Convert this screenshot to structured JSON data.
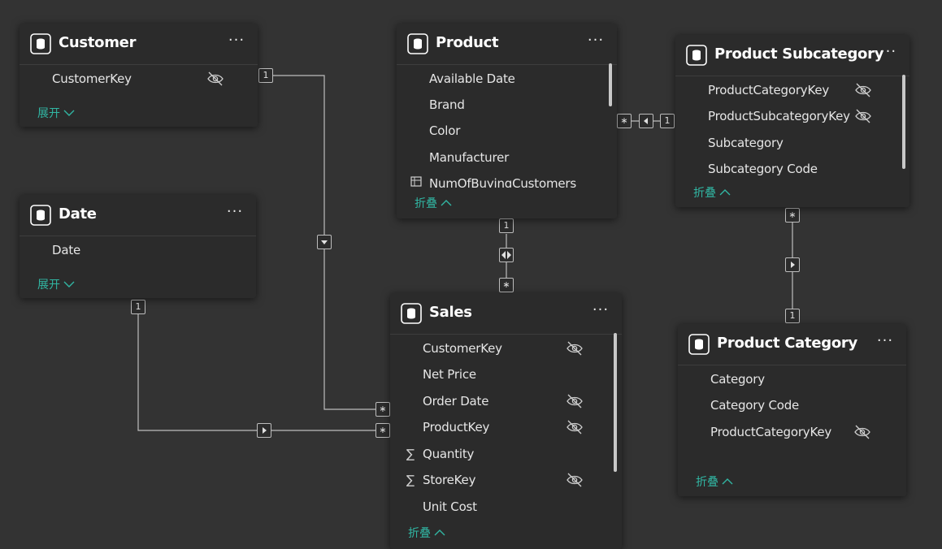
{
  "tables": {
    "customer": {
      "title": "Customer",
      "more": "···",
      "fields": [
        "CustomerKey"
      ],
      "toggle": "展开"
    },
    "date": {
      "title": "Date",
      "more": "···",
      "fields": [
        "Date"
      ],
      "toggle": "展开"
    },
    "product": {
      "title": "Product",
      "more": "···",
      "fields": [
        "Available Date",
        "Brand",
        "Color",
        "Manufacturer",
        "NumOfBuyingCustomers"
      ],
      "toggle": "折叠"
    },
    "product_subcategory": {
      "title": "Product Subcategory",
      "more": "···",
      "fields": [
        "ProductCategoryKey",
        "ProductSubcategoryKey",
        "Subcategory",
        "Subcategory Code"
      ],
      "toggle": "折叠"
    },
    "sales": {
      "title": "Sales",
      "more": "···",
      "fields": [
        "CustomerKey",
        "Net Price",
        "Order Date",
        "ProductKey",
        "Quantity",
        "StoreKey",
        "Unit Cost"
      ],
      "sigma": "∑",
      "toggle": "折叠"
    },
    "product_category": {
      "title": "Product Category",
      "more": "···",
      "fields": [
        "Category",
        "Category Code",
        "ProductCategoryKey"
      ],
      "toggle": "折叠"
    }
  },
  "relationships": {
    "one": "1",
    "many": "∗"
  },
  "colors": {
    "background": "#333333",
    "card": "#2b2b2b",
    "accent": "#31b6a3",
    "line": "#bdbdbd"
  }
}
